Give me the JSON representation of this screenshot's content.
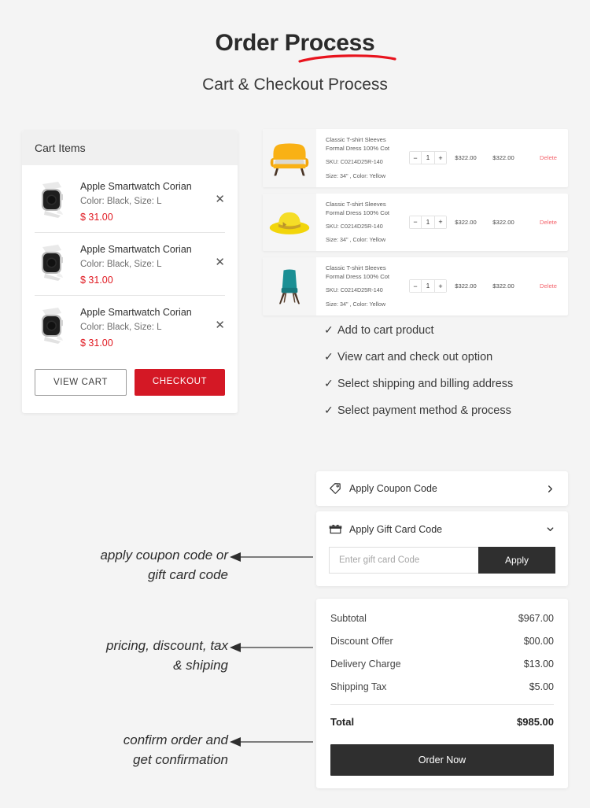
{
  "header": {
    "title": "Order Process",
    "subtitle": "Cart & Checkout Process",
    "accent_color": "#e8131d"
  },
  "cart_panel": {
    "header_label": "Cart Items",
    "items": [
      {
        "name": "Apple Smartwatch Corian",
        "meta": "Color: Black, Size: L",
        "price": "$ 31.00",
        "remove_icon": "close-icon"
      },
      {
        "name": "Apple Smartwatch Corian",
        "meta": "Color: Black, Size: L",
        "price": "$ 31.00",
        "remove_icon": "close-icon"
      },
      {
        "name": "Apple Smartwatch Corian",
        "meta": "Color: Black, Size: L",
        "price": "$ 31.00",
        "remove_icon": "close-icon"
      }
    ],
    "view_cart_label": "VIEW CART",
    "checkout_label": "CHECKOUT",
    "price_color": "#e01a22",
    "checkout_color": "#d41825"
  },
  "products": [
    {
      "thumb": "yellow-sofa",
      "title": "Classic T-shirt Sleeves Formal Dress 100% Cot",
      "sku": "SKU: C0214D25R-140",
      "variant": "Size: 34\" , Color: Yellow",
      "qty_minus": "−",
      "qty": "1",
      "qty_plus": "+",
      "unit_price": "$322.00",
      "total_price": "$322.00",
      "delete_label": "Delete"
    },
    {
      "thumb": "yellow-hat",
      "title": "Classic T-shirt Sleeves Formal Dress 100% Cot",
      "sku": "SKU: C0214D25R-140",
      "variant": "Size: 34\" , Color: Yellow",
      "qty_minus": "−",
      "qty": "1",
      "qty_plus": "+",
      "unit_price": "$322.00",
      "total_price": "$322.00",
      "delete_label": "Delete"
    },
    {
      "thumb": "teal-chair",
      "title": "Classic T-shirt Sleeves Formal Dress 100% Cot",
      "sku": "SKU: C0214D25R-140",
      "variant": "Size: 34\" , Color: Yellow",
      "qty_minus": "−",
      "qty": "1",
      "qty_plus": "+",
      "unit_price": "$322.00",
      "total_price": "$322.00",
      "delete_label": "Delete"
    }
  ],
  "checklist": {
    "check_glyph": "✓",
    "items": [
      "Add to cart product",
      "View cart and check out option",
      "Select shipping and billing address",
      "Select payment method & process"
    ]
  },
  "coupon": {
    "label": "Apply Coupon Code",
    "icon": "tag-icon",
    "chevron": "chevron-right-icon"
  },
  "gift_card": {
    "label": "Apply Gift Card Code",
    "icon": "gift-icon",
    "chevron": "chevron-down-icon",
    "placeholder": "Enter gift card Code",
    "value": "",
    "apply_label": "Apply"
  },
  "summary": {
    "rows": [
      {
        "label": "Subtotal",
        "value": "$967.00"
      },
      {
        "label": "Discount Offer",
        "value": "$00.00"
      },
      {
        "label": "Delivery Charge",
        "value": "$13.00"
      },
      {
        "label": "Shipping Tax",
        "value": "$5.00"
      }
    ],
    "total_label": "Total",
    "total_value": "$985.00",
    "order_button_label": "Order Now"
  },
  "annotations": [
    {
      "line1": "apply coupon code or",
      "line2": "gift card code"
    },
    {
      "line1": "pricing, discount, tax",
      "line2": "& shiping"
    },
    {
      "line1": "confirm order and",
      "line2": "get confirmation"
    }
  ]
}
